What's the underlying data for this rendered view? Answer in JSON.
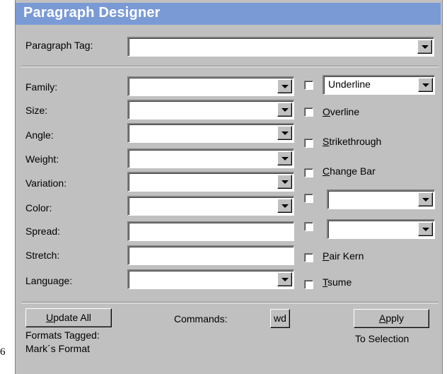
{
  "window": {
    "title": "Paragraph Designer",
    "side_mark": "6"
  },
  "paragraph_tag": {
    "label": "Paragraph Tag:",
    "value": ""
  },
  "properties": [
    {
      "label": "Family:",
      "value": ""
    },
    {
      "label": "Size:",
      "value": ""
    },
    {
      "label": "Angle:",
      "value": ""
    },
    {
      "label": "Weight:",
      "value": ""
    },
    {
      "label": "Variation:",
      "value": ""
    },
    {
      "label": "Color:",
      "value": ""
    },
    {
      "label": "Spread:",
      "value": ""
    },
    {
      "label": "Stretch:",
      "value": ""
    },
    {
      "label": "Language:",
      "value": ""
    }
  ],
  "options": {
    "underline_select": "Underline",
    "overline": {
      "mnemonic": "O",
      "rest": "verline"
    },
    "strikethrough": {
      "mnemonic": "S",
      "rest": "trikethrough"
    },
    "change_bar": {
      "mnemonic": "C",
      "rest": "hange Bar"
    },
    "pair_kern": {
      "mnemonic": "P",
      "rest": "air Kern"
    },
    "tsume": {
      "mnemonic": "T",
      "rest": "sume"
    }
  },
  "footer": {
    "update_all": {
      "mnemonic": "U",
      "rest": "pdate All"
    },
    "formats_tagged": "Formats Tagged:",
    "marks_format": "Mark´s Format",
    "commands_label": "Commands:",
    "commands_value": "wd",
    "apply": {
      "mnemonic": "A",
      "rest": "pply"
    },
    "to_selection": "To Selection"
  }
}
